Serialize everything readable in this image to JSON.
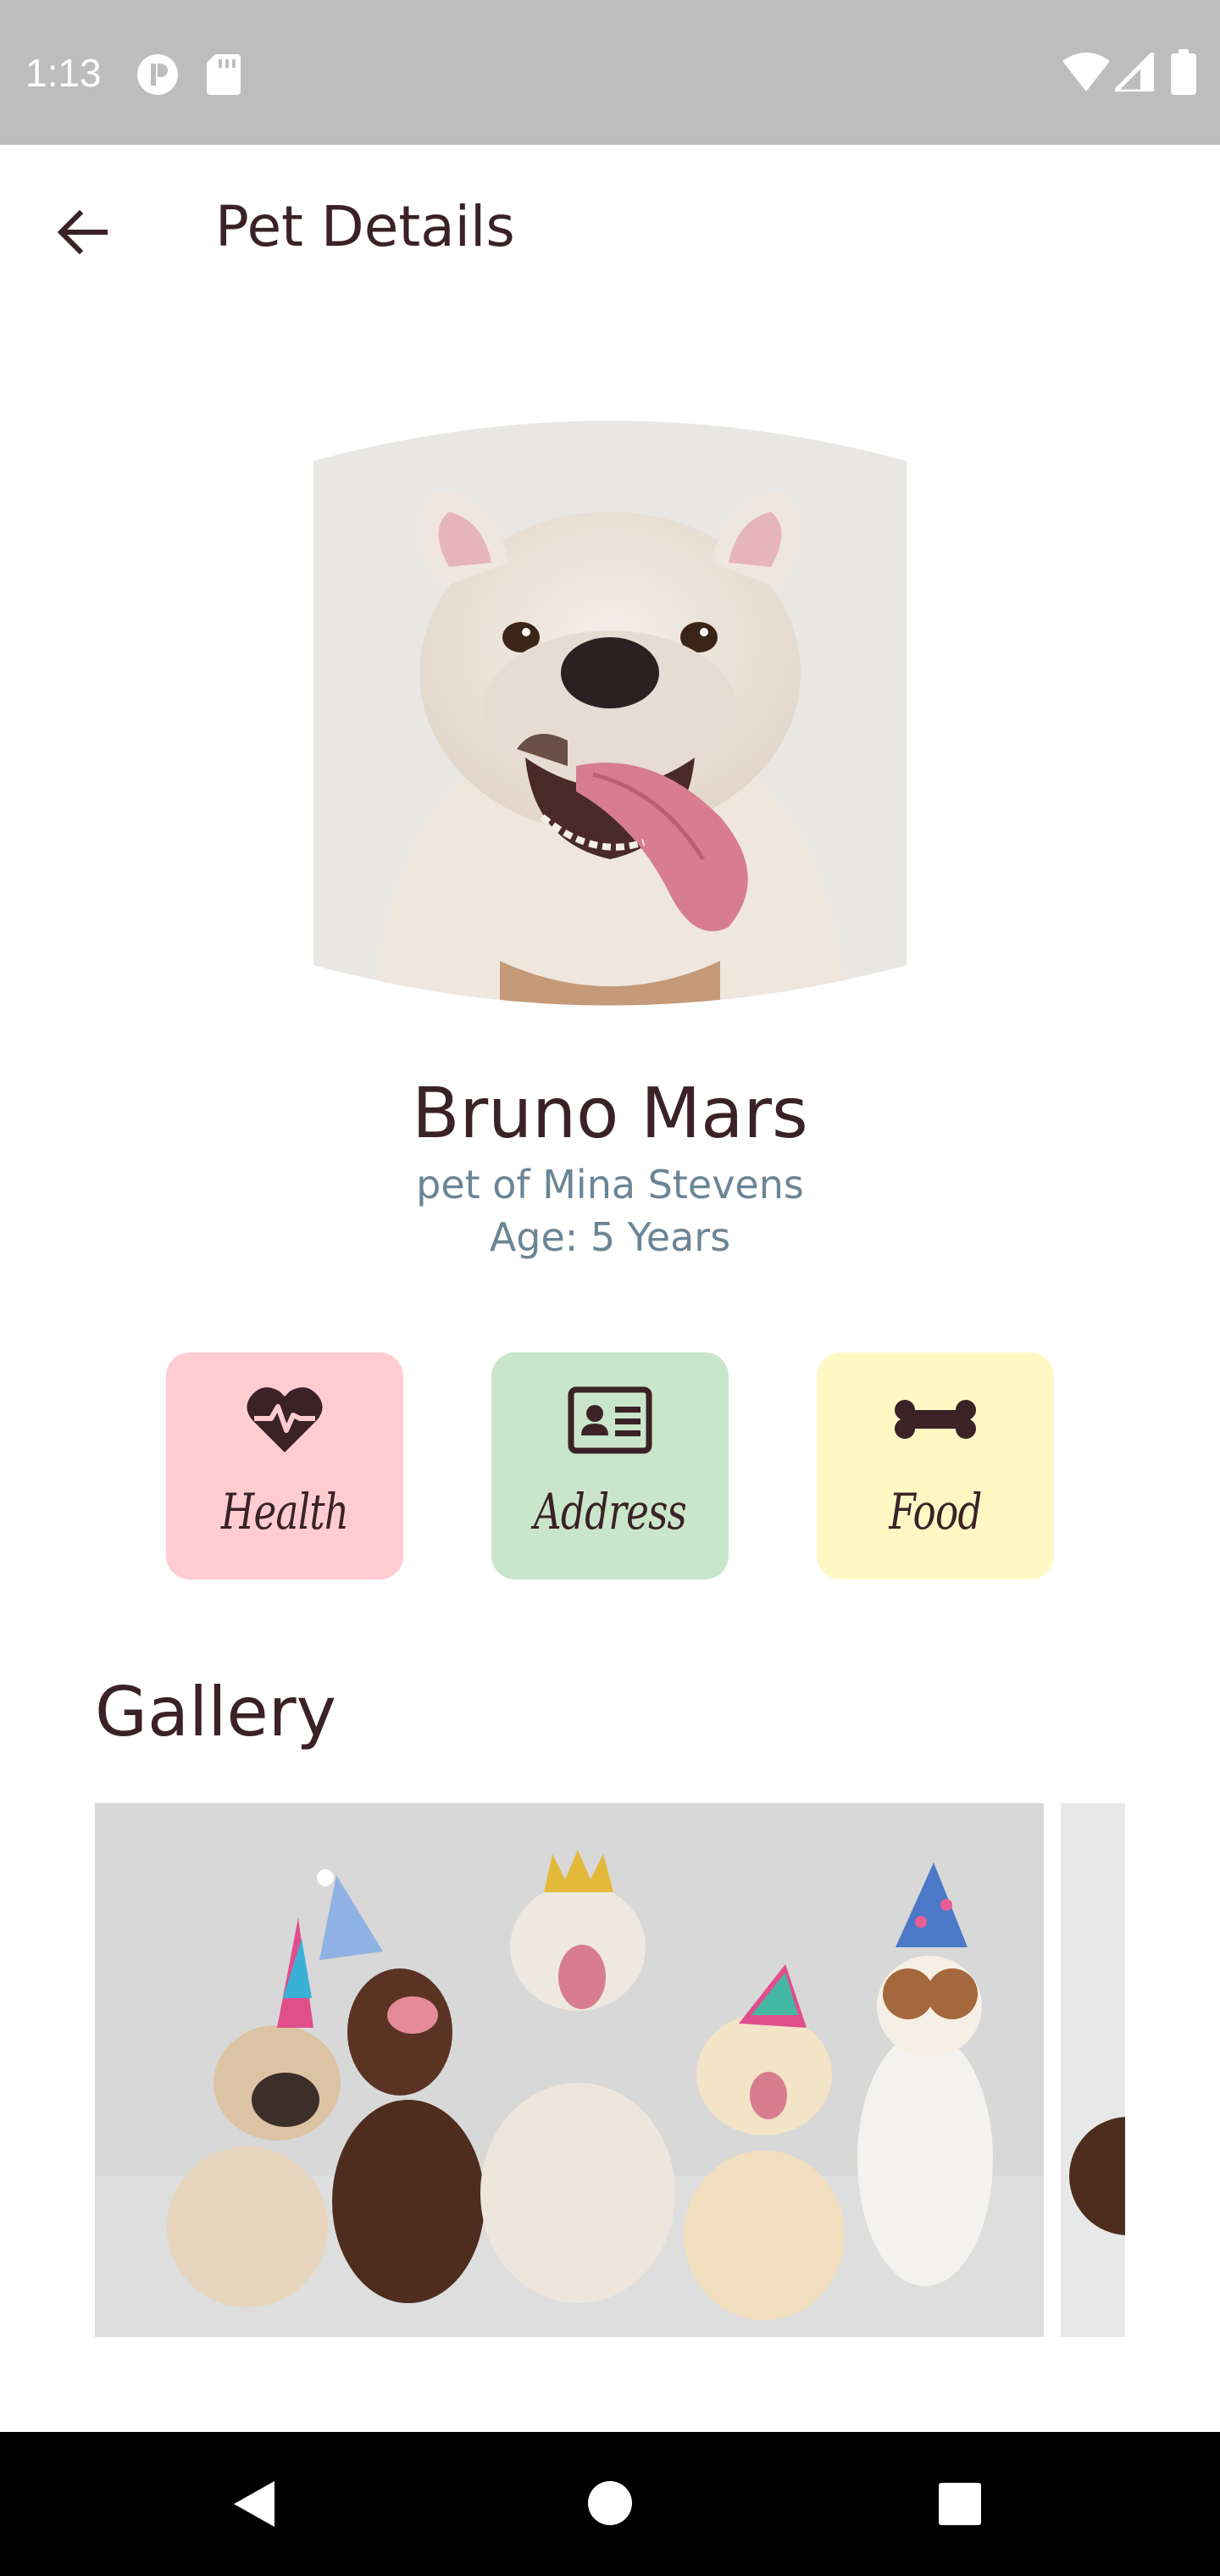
{
  "status_bar": {
    "time": "1:13",
    "background": "#bdbdbd",
    "icons": [
      "app-notification-icon",
      "sd-card-icon",
      "wifi-icon",
      "cellular-signal-icon",
      "battery-icon"
    ]
  },
  "app_bar": {
    "back_icon": "arrow-left-icon",
    "title": "Pet Details"
  },
  "pet": {
    "photo": "bulldog-portrait",
    "name": "Bruno Mars",
    "owner": "pet of Mina Stevens",
    "age": "Age: 5 Years"
  },
  "categories": [
    {
      "label": "Health",
      "icon": "heart-pulse-icon",
      "color": "#ffccd2"
    },
    {
      "label": "Address",
      "icon": "id-card-icon",
      "color": "#c9e6cb"
    },
    {
      "label": "Food",
      "icon": "bone-icon",
      "color": "#fff8c5"
    }
  ],
  "gallery": {
    "title": "Gallery",
    "images": [
      "party-dogs-photo",
      "dog-photo"
    ]
  },
  "nav_bar": {
    "buttons": [
      "back-triangle-icon",
      "home-circle-icon",
      "recents-square-icon"
    ]
  },
  "colors": {
    "primary_text": "#3a2226",
    "secondary_text": "#6b8596"
  }
}
